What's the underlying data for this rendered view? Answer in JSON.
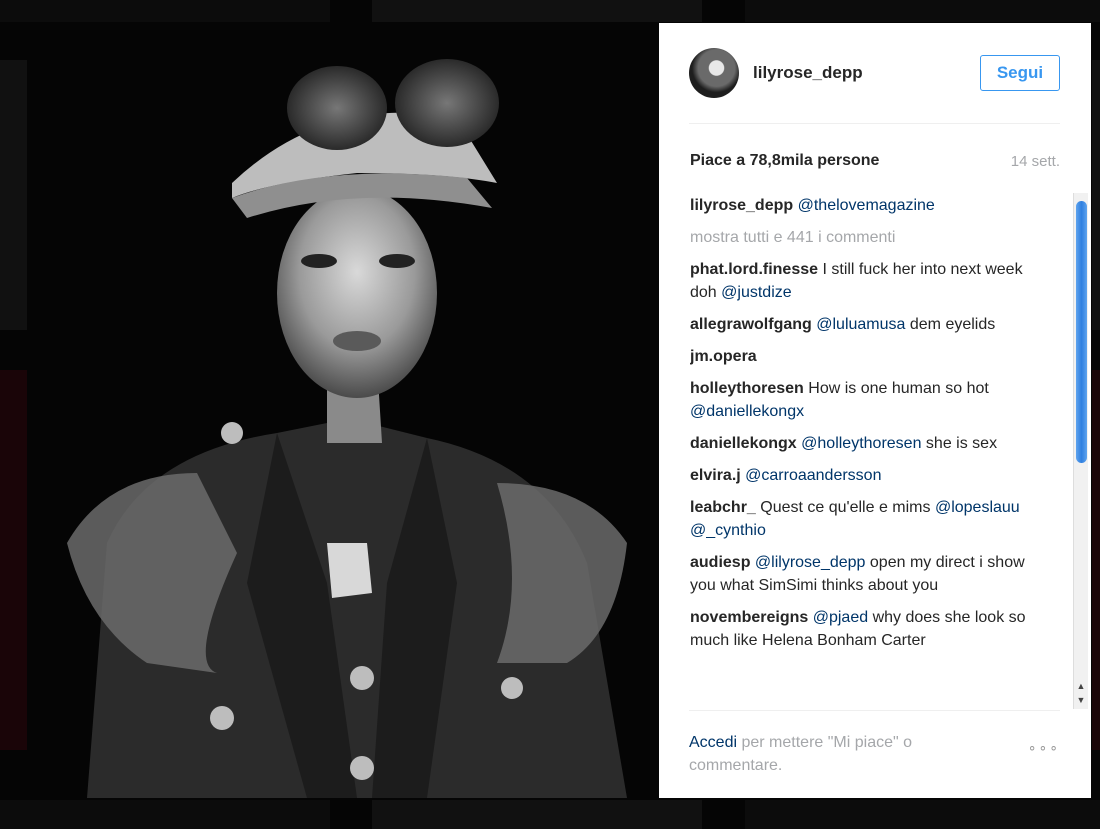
{
  "post": {
    "username": "lilyrose_depp",
    "follow_label": "Segui",
    "likes": "Piace a 78,8mila persone",
    "time": "14 sett.",
    "caption": {
      "user": "lilyrose_depp",
      "mention": "@thelovemagazine"
    },
    "show_all": "mostra tutti e 441 i commenti"
  },
  "comments": [
    {
      "user": "phat.lord.finesse",
      "pre": "I still fuck her into next week doh",
      "mention": "@justdize",
      "post": ""
    },
    {
      "user": "allegrawolfgang",
      "pre": "",
      "mention": "@luluamusa",
      "post": "dem eyelids"
    },
    {
      "user": "jm.opera",
      "pre": "",
      "mention": "",
      "post": ""
    },
    {
      "user": "holleythoresen",
      "pre": "How is one human so hot",
      "mention": "@daniellekongx",
      "post": ""
    },
    {
      "user": "daniellekongx",
      "pre": "",
      "mention": "@holleythoresen",
      "post": "she is sex"
    },
    {
      "user": "elvira.j",
      "pre": "",
      "mention": "@carroaandersson",
      "post": ""
    },
    {
      "user": "leabchr_",
      "pre": "Quest ce qu'elle e mims",
      "mention": "@lopeslauu @_cynthio",
      "post": ""
    },
    {
      "user": "audiesp",
      "pre": "",
      "mention": "@lilyrose_depp",
      "post": "open my direct i show you what SimSimi thinks about you"
    },
    {
      "user": "novembereigns",
      "pre": "",
      "mention": "@pjaed",
      "post": "why does she look so much like Helena Bonham Carter"
    }
  ],
  "footer": {
    "login": "Accedi",
    "rest": "per mettere \"Mi piace\" o commentare.",
    "more": "∘∘∘"
  },
  "icons": {
    "options": "more-options-icon",
    "scroll_up": "scroll-up-arrow",
    "scroll_down": "scroll-down-arrow"
  },
  "colors": {
    "link_blue": "#003569",
    "button_blue": "#3897f0",
    "muted": "#a5a7aa"
  }
}
